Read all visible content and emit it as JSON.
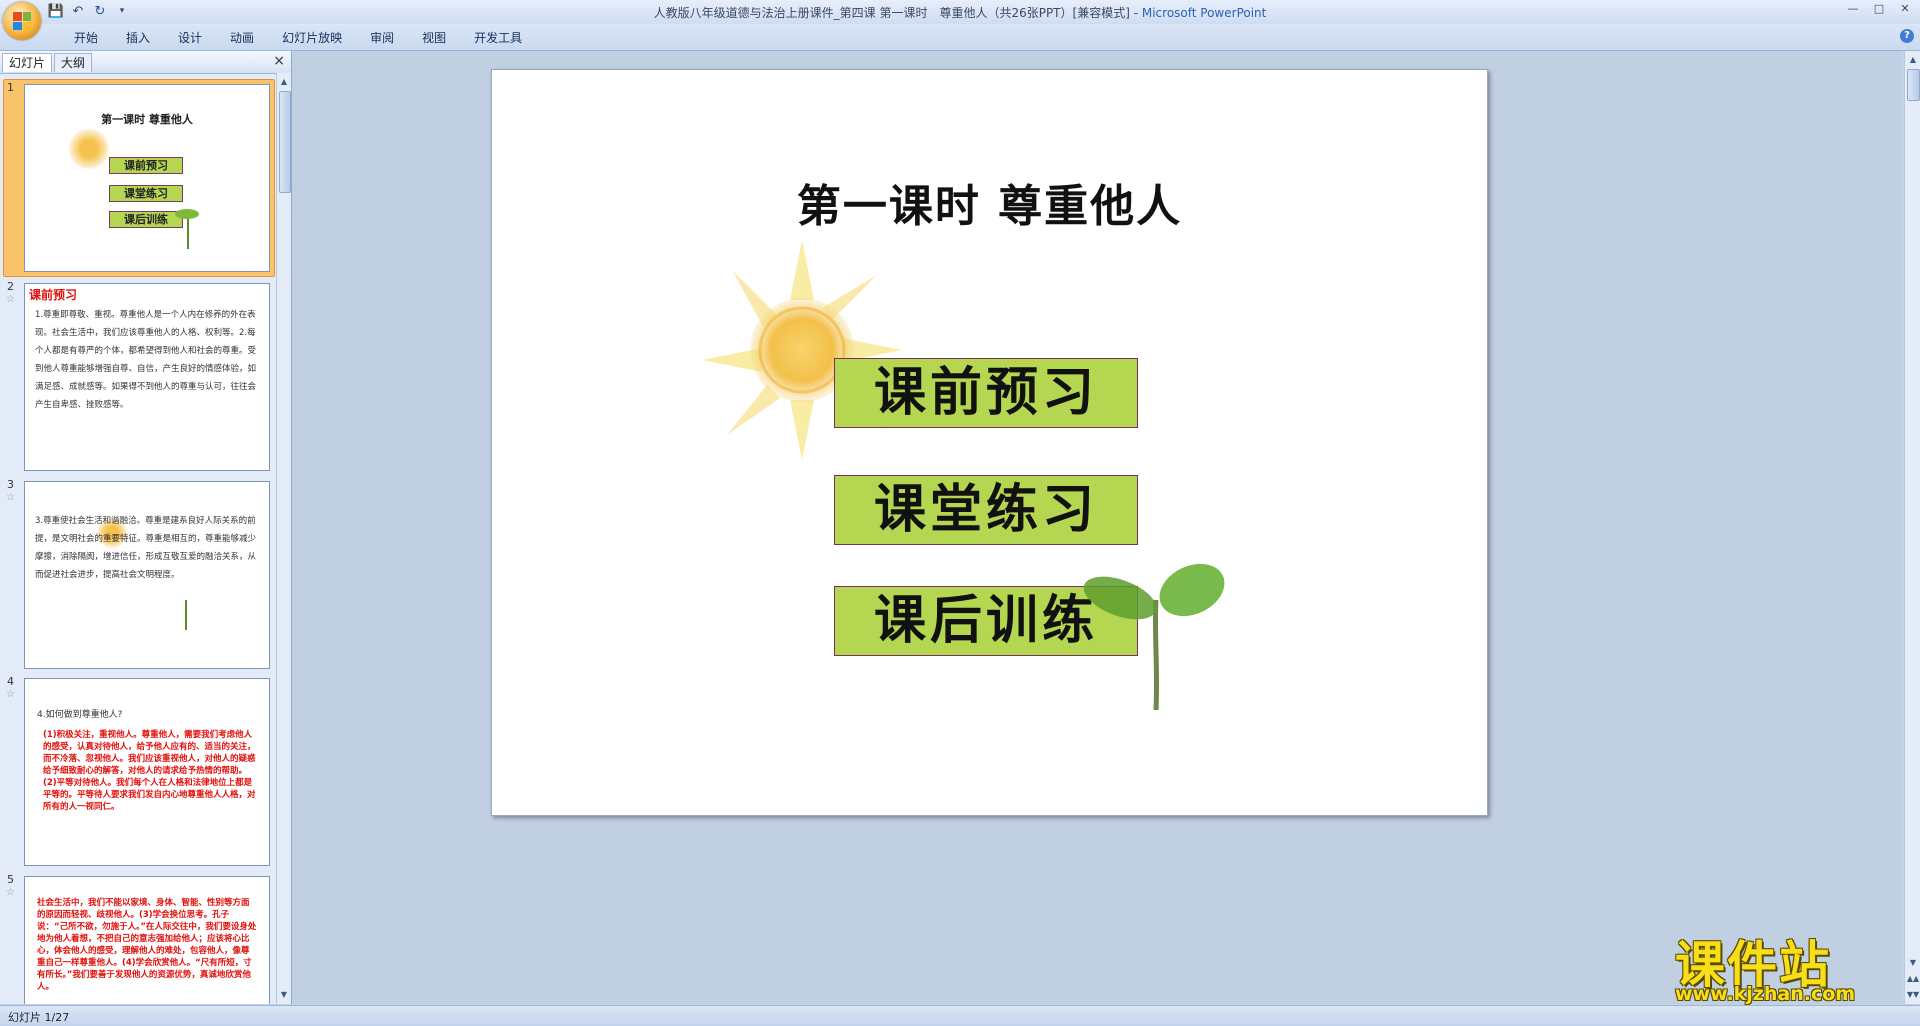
{
  "window": {
    "title": "人教版八年级道德与法治上册课件_第四课 第一课时　尊重他人（共26张PPT）[兼容模式]",
    "app_name": "Microsoft PowerPoint",
    "dash": " - "
  },
  "ribbon": {
    "tabs": [
      "开始",
      "插入",
      "设计",
      "动画",
      "幻灯片放映",
      "审阅",
      "视图",
      "开发工具"
    ]
  },
  "panel": {
    "tab_slides": "幻灯片",
    "tab_outline": "大纲",
    "close": "×"
  },
  "thumbnails": [
    {
      "num": "1",
      "title": "第一课时 尊重他人",
      "buttons": [
        "课前预习",
        "课堂练习",
        "课后训练"
      ]
    },
    {
      "num": "2",
      "heading": "课前预习",
      "text": "1.尊重即尊敬、重视。尊重他人是一个人内在修养的外在表现。社会生活中，我们应该尊重他人的人格、权利等。2.每个人都是有尊严的个体，都希望得到他人和社会的尊重。受到他人尊重能够增强自尊、自信，产生良好的情感体验，如满足感、成就感等。如果得不到他人的尊重与认可，往往会产生自卑感、挫败感等。"
    },
    {
      "num": "3",
      "text": "3.尊重使社会生活和谐融洽。尊重是建系良好人际关系的前提，是文明社会的重要特征。尊重是相互的，尊重能够减少摩擦，消除隔阂，增进信任，形成互敬互爱的融洽关系，从而促进社会进步，提高社会文明程度。"
    },
    {
      "num": "4",
      "question": "4.如何做到尊重他人?",
      "text": "(1)积极关注，重视他人。尊重他人，需要我们考虑他人的感受，认真对待他人，给予他人应有的、适当的关注，而不冷落、忽视他人。我们应该重视他人，对他人的疑惑给予细致耐心的解答，对他人的请求给予热情的帮助。(2)平等对待他人。我们每个人在人格和法律地位上都是平等的。平等待人要求我们发自内心地尊重他人人格，对所有的人一视同仁。"
    },
    {
      "num": "5",
      "text": "社会生活中，我们不能以家境、身体、智能、性别等方面的原因而轻视、歧视他人。(3)学会换位思考。孔子说：“己所不欲，勿施于人。”在人际交往中，我们要设身处地为他人着想，不把自己的意志强加给他人；应该将心比心，体会他人的感受，理解他人的难处，包容他人，像尊重自己一样尊重他人。(4)学会欣赏他人。“尺有所短，寸有所长。”我们要善于发现他人的资源优势，真诚地欣赏他人。"
    }
  ],
  "slide": {
    "title": "第一课时 尊重他人",
    "buttons": [
      "课前预习",
      "课堂练习",
      "课后训练"
    ]
  },
  "status": {
    "text": "幻灯片 1/27"
  },
  "watermark": {
    "title": "课件站",
    "url": "www.kjzhan.com"
  }
}
